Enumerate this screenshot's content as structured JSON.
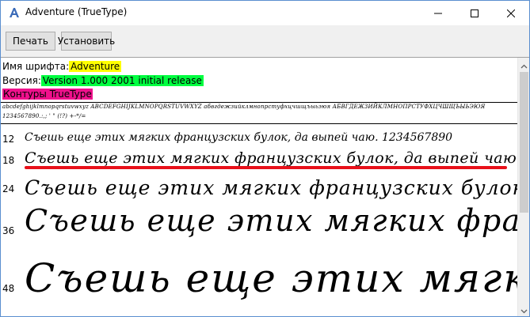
{
  "window": {
    "title": "Adventure (TrueType)"
  },
  "toolbar": {
    "print_label": "Печать",
    "install_label": "Установить"
  },
  "info": {
    "font_name_label": "Имя шрифта:",
    "font_name_value": "Adventure",
    "version_label": "Версия:",
    "version_value": "Version 1.000 2001 initial release",
    "outline_value": "Контуры TrueType"
  },
  "charset": {
    "line1": "abcdefghijklmnopqrstuvwxyz ABCDEFGHIJKLMNOPQRSTUVWXYZ абвгдежзийклмнопрстуфхцчшщъыьэюя АБВГДЕЖЗИЙКЛМНОПРСТУФХЦЧШЩЪЫЬЭЮЯ",
    "line2": "1234567890.:,; ' \" (!?) +-*/="
  },
  "samples": [
    {
      "size": "12",
      "text": "Съешь еще этих мягких французских булок, да выпей чаю. 1234567890"
    },
    {
      "size": "18",
      "text": "Съешь еще этих мягких французских булок, да выпей чаю."
    },
    {
      "size": "24",
      "text": "Съешь еще этих мягких французских булок, да выпей чаю."
    },
    {
      "size": "36",
      "text": "Съешь еще этих мягких французских булок, да выпей чаю."
    },
    {
      "size": "48",
      "text": "Съешь еще этих мягких французских булок, да выпей чаю."
    }
  ],
  "colors": {
    "highlight_name": "#ffff00",
    "highlight_version": "#00ff40",
    "highlight_outline": "#f0108c",
    "annotation_underline": "#e8101a"
  },
  "icons": {
    "app": "font-viewer-icon",
    "minimize": "minimize-icon",
    "maximize": "maximize-icon",
    "close": "close-icon",
    "scroll_up": "chevron-up-icon",
    "scroll_down": "chevron-down-icon"
  }
}
